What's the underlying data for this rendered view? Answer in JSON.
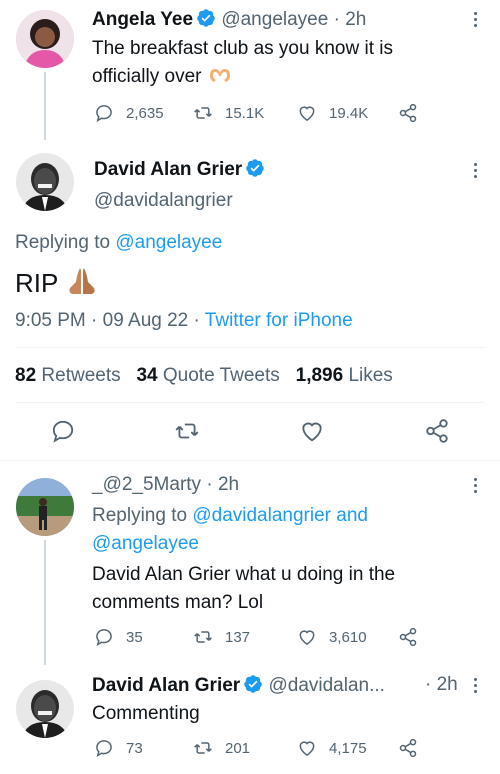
{
  "tweet1": {
    "name": "Angela Yee",
    "handle": "@angelayee",
    "time": "· 2h",
    "text": "The breakfast club as you know it is officially over",
    "replies": "2,635",
    "retweets": "15.1K",
    "likes": "19.4K"
  },
  "main": {
    "name": "David Alan Grier",
    "handle": "@davidalangrier",
    "replying_prefix": "Replying to ",
    "replying_to": "@angelayee",
    "text": "RIP",
    "time": "9:05 PM",
    "date": "09 Aug 22",
    "source": "Twitter for iPhone",
    "sep": "·",
    "stats": {
      "retweets_count": "82",
      "retweets_label": "Retweets",
      "quotes_count": "34",
      "quotes_label": "Quote Tweets",
      "likes_count": "1,896",
      "likes_label": "Likes"
    }
  },
  "reply1": {
    "handle": "_@2_5Marty",
    "time": "· 2h",
    "replying_prefix": "Replying to ",
    "replying_to": "@davidalangrier and",
    "replying_to2": "@angelayee",
    "text": "David Alan Grier what u doing in the comments man? Lol",
    "replies": "35",
    "retweets": "137",
    "likes": "3,610"
  },
  "reply2": {
    "name": "David Alan Grier",
    "handle": "@davidalan...",
    "time": "· 2h",
    "text": "Commenting",
    "replies": "73",
    "retweets": "201",
    "likes": "4,175"
  },
  "colors": {
    "accent": "#1d9bf0",
    "muted": "#536471",
    "text": "#0f1419"
  }
}
